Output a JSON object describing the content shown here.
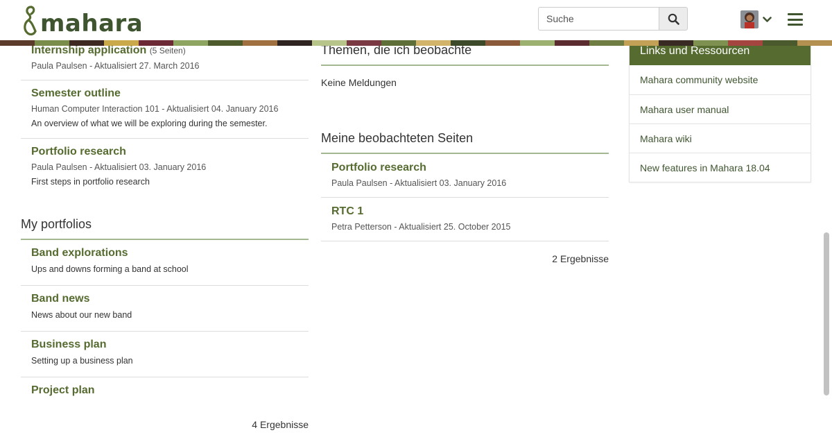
{
  "header": {
    "logo_text": "mahara",
    "search_placeholder": "Suche",
    "colors": {
      "brand": "#3f5530",
      "accent": "#556b2f"
    }
  },
  "left": {
    "pages": [
      {
        "title": "Internship application",
        "count": "(5 Seiten)",
        "meta": "Paula Paulsen - Aktualisiert 27. March 2016",
        "desc": ""
      },
      {
        "title": "Semester outline",
        "count": "",
        "meta": "Human Computer Interaction 101 - Aktualisiert 04. January 2016",
        "desc": "An overview of what we will be exploring during the semester."
      },
      {
        "title": "Portfolio research",
        "count": "",
        "meta": "Paula Paulsen - Aktualisiert 03. January 2016",
        "desc": "First steps in portfolio research"
      }
    ],
    "portfolios_heading": "My portfolios",
    "portfolios": [
      {
        "title": "Band explorations",
        "desc": "Ups and downs forming a band at school"
      },
      {
        "title": "Band news",
        "desc": "News about our new band"
      },
      {
        "title": "Business plan",
        "desc": "Setting up a business plan"
      },
      {
        "title": "Project plan",
        "desc": ""
      }
    ],
    "portfolios_results": "4 Ergebnisse"
  },
  "middle": {
    "topics_heading": "Themen, die ich beobachte",
    "topics_empty": "Keine Meldungen",
    "watched_heading": "Meine beobachteten Seiten",
    "watched": [
      {
        "title": "Portfolio research",
        "meta": "Paula Paulsen - Aktualisiert 03. January 2016"
      },
      {
        "title": "RTC 1",
        "meta": "Petra Petterson - Aktualisiert 25. October 2015"
      }
    ],
    "watched_results": "2 Ergebnisse"
  },
  "right": {
    "title": "Links und Ressourcen",
    "links": [
      "Mahara community website",
      "Mahara user manual",
      "Mahara wiki",
      "New features in Mahara 18.04"
    ]
  }
}
